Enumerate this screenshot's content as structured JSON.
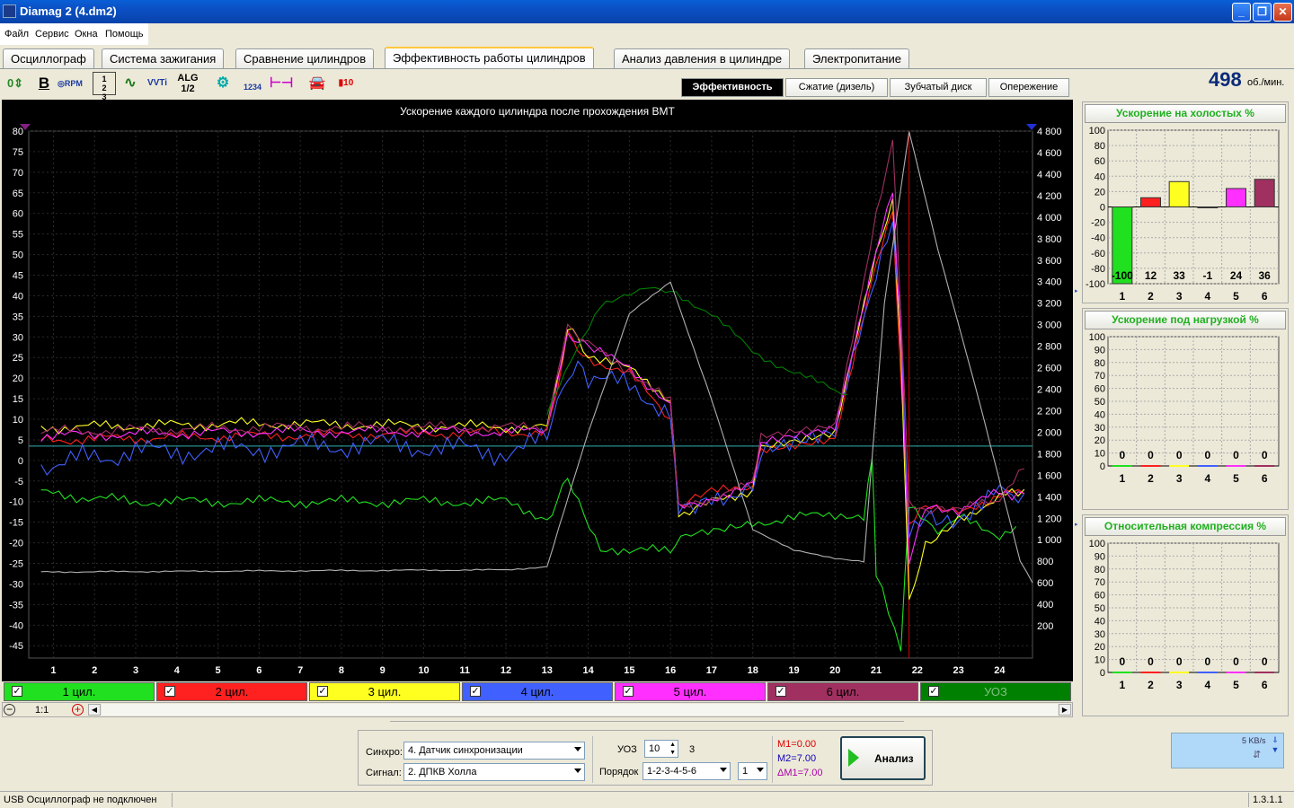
{
  "window": {
    "title": "Diamag 2 (4.dm2)"
  },
  "menu": [
    "Файл",
    "Сервис",
    "Окна",
    "Помощь"
  ],
  "tabs": [
    "Осциллограф",
    "Система зажигания",
    "Сравнение цилиндров",
    "Эффективность работы цилиндров",
    "Анализ давления в цилиндре",
    "Электропитание"
  ],
  "active_tab": 3,
  "toolbar": [
    "0",
    "B",
    "RPM",
    "1|2|3",
    "line",
    "VVTi",
    "ALG 1/2",
    "cyl-icon",
    "1234",
    "sync",
    "car-icon",
    "10"
  ],
  "subtabs": [
    "Эффективность",
    "Сжатие (дизель)",
    "Зубчатый диск",
    "Опережение"
  ],
  "active_subtab": 0,
  "rpm": {
    "value": "498",
    "unit": "об./мин."
  },
  "channels": [
    {
      "label": "1 цил.",
      "color": "#20e020"
    },
    {
      "label": "2 цил.",
      "color": "#ff2020"
    },
    {
      "label": "3 цил.",
      "color": "#ffff20"
    },
    {
      "label": "4 цил.",
      "color": "#4060ff"
    },
    {
      "label": "5 цил.",
      "color": "#ff30ff"
    },
    {
      "label": "6 цил.",
      "color": "#a03060"
    },
    {
      "label": "УОЗ",
      "color": "#008000"
    }
  ],
  "zoom": {
    "label": "1:1"
  },
  "chart_data": [
    {
      "type": "line",
      "title": "Ускорение каждого цилиндра после прохождения ВМТ",
      "xlim": [
        0.4,
        24.8
      ],
      "xticks": [
        1,
        2,
        3,
        4,
        5,
        6,
        7,
        8,
        9,
        10,
        11,
        12,
        13,
        14,
        15,
        16,
        17,
        18,
        19,
        20,
        21,
        22,
        23,
        24
      ],
      "ylim": [
        -48,
        80
      ],
      "yticks": [
        80,
        75,
        70,
        65,
        60,
        55,
        50,
        45,
        40,
        35,
        30,
        25,
        20,
        15,
        10,
        5,
        0,
        -5,
        -10,
        -15,
        -20,
        -25,
        -30,
        -35,
        -40,
        -45
      ],
      "y2lim": [
        -100,
        4800
      ],
      "y2ticks": [
        "4 800",
        "4 600",
        "4 400",
        "4 200",
        "4 000",
        "3 800",
        "3 600",
        "3 400",
        "3 200",
        "3 000",
        "2 800",
        "2 600",
        "2 400",
        "2 200",
        "2 000",
        "1 800",
        "1 600",
        "1 400",
        "1 200",
        "1 000",
        "800",
        "600",
        "400",
        "200"
      ],
      "reference_line": 3.5,
      "series": [
        {
          "name": "1 цил.",
          "color": "#20e020",
          "points": [
            [
              0.7,
              -8
            ],
            [
              3,
              -10
            ],
            [
              6,
              -10
            ],
            [
              9,
              -10
            ],
            [
              12,
              -10
            ],
            [
              13,
              -14
            ],
            [
              13.5,
              -5
            ],
            [
              14.3,
              -21
            ],
            [
              15,
              -22
            ],
            [
              16,
              -22
            ],
            [
              16.5,
              -17
            ],
            [
              18,
              -15
            ],
            [
              20,
              -13
            ],
            [
              20.7,
              -13
            ],
            [
              20.9,
              2
            ],
            [
              21,
              -28
            ],
            [
              21.6,
              -45
            ],
            [
              21.8,
              -10
            ],
            [
              22.5,
              -17
            ],
            [
              23,
              -14
            ],
            [
              24,
              -18
            ],
            [
              24.4,
              -16
            ]
          ]
        },
        {
          "name": "2 цил.",
          "color": "#ff2020",
          "points": [
            [
              0.7,
              5
            ],
            [
              6,
              6
            ],
            [
              13,
              7
            ],
            [
              13.5,
              30
            ],
            [
              14,
              25
            ],
            [
              15,
              21
            ],
            [
              16,
              10
            ],
            [
              16.2,
              -11
            ],
            [
              17,
              -8
            ],
            [
              18,
              -6
            ],
            [
              18.2,
              3
            ],
            [
              20,
              6
            ],
            [
              21,
              47
            ],
            [
              21.4,
              60
            ],
            [
              21.6,
              20
            ],
            [
              21.8,
              -15
            ],
            [
              22.2,
              -10
            ],
            [
              23,
              -13
            ],
            [
              24,
              -8
            ],
            [
              24.6,
              -8
            ]
          ]
        },
        {
          "name": "3 цил.",
          "color": "#ffff20",
          "points": [
            [
              0.7,
              8
            ],
            [
              6,
              9
            ],
            [
              13,
              8
            ],
            [
              13.5,
              32
            ],
            [
              14,
              26
            ],
            [
              15,
              22
            ],
            [
              16,
              15
            ],
            [
              16.2,
              -13
            ],
            [
              17,
              -10
            ],
            [
              18,
              -7
            ],
            [
              18.2,
              4
            ],
            [
              20,
              7
            ],
            [
              21,
              50
            ],
            [
              21.4,
              62
            ],
            [
              21.6,
              25
            ],
            [
              21.8,
              -35
            ],
            [
              22.2,
              -20
            ],
            [
              23,
              -14
            ],
            [
              24,
              -9
            ],
            [
              24.6,
              -7
            ]
          ]
        },
        {
          "name": "4 цил.",
          "color": "#4060ff",
          "points": [
            [
              0.7,
              -1
            ],
            [
              3,
              2
            ],
            [
              6,
              3
            ],
            [
              9,
              4
            ],
            [
              12,
              2
            ],
            [
              13,
              5
            ],
            [
              13.5,
              22
            ],
            [
              14,
              20
            ],
            [
              15,
              18
            ],
            [
              16,
              12
            ],
            [
              16.2,
              -10
            ],
            [
              17,
              -9
            ],
            [
              18,
              -6
            ],
            [
              18.2,
              3
            ],
            [
              20,
              6
            ],
            [
              21,
              46
            ],
            [
              21.4,
              58
            ],
            [
              21.6,
              35
            ],
            [
              21.8,
              -20
            ],
            [
              22.2,
              -14
            ],
            [
              23,
              -13
            ],
            [
              24,
              -8
            ],
            [
              24.6,
              -8
            ]
          ]
        },
        {
          "name": "5 цил.",
          "color": "#ff30ff",
          "points": [
            [
              0.7,
              6
            ],
            [
              6,
              7
            ],
            [
              13,
              7
            ],
            [
              13.5,
              31
            ],
            [
              14,
              27
            ],
            [
              15,
              23
            ],
            [
              16,
              13
            ],
            [
              16.2,
              -11
            ],
            [
              17,
              -9
            ],
            [
              18,
              -6
            ],
            [
              18.2,
              4
            ],
            [
              20,
              7
            ],
            [
              21,
              52
            ],
            [
              21.4,
              66
            ],
            [
              21.6,
              30
            ],
            [
              21.8,
              -25
            ],
            [
              22.2,
              -12
            ],
            [
              23,
              -12
            ],
            [
              24,
              -8
            ],
            [
              24.6,
              -8
            ]
          ]
        },
        {
          "name": "6 цил.",
          "color": "#a03060",
          "points": [
            [
              0.7,
              7
            ],
            [
              6,
              8
            ],
            [
              13,
              8
            ],
            [
              13.5,
              33
            ],
            [
              14,
              28
            ],
            [
              15,
              22
            ],
            [
              16,
              14
            ],
            [
              16.2,
              -12
            ],
            [
              17,
              -9
            ],
            [
              18,
              -6
            ],
            [
              18.2,
              5
            ],
            [
              20,
              8
            ],
            [
              21,
              60
            ],
            [
              21.4,
              78
            ],
            [
              21.6,
              35
            ],
            [
              21.8,
              -10
            ],
            [
              22.2,
              -13
            ],
            [
              23,
              -12
            ],
            [
              24,
              -10
            ],
            [
              24.2,
              -7
            ],
            [
              24.6,
              -2
            ]
          ]
        },
        {
          "name": "УОЗ",
          "color": "#008000",
          "axis": "right",
          "points": [
            [
              13,
              2200
            ],
            [
              14.3,
              3200
            ],
            [
              15,
              3300
            ],
            [
              15.5,
              3340
            ],
            [
              16,
              3320
            ],
            [
              17,
              3100
            ],
            [
              18,
              2750
            ],
            [
              19,
              2550
            ],
            [
              20,
              2400
            ],
            [
              20.3,
              2350
            ]
          ]
        },
        {
          "name": "обороты",
          "color": "#b0b0b0",
          "axis": "right",
          "points": [
            [
              0.7,
              700
            ],
            [
              6,
              710
            ],
            [
              12,
              720
            ],
            [
              13,
              750
            ],
            [
              14,
              2000
            ],
            [
              15,
              3100
            ],
            [
              16,
              3400
            ],
            [
              17,
              2300
            ],
            [
              18,
              1100
            ],
            [
              19,
              900
            ],
            [
              20,
              830
            ],
            [
              20.7,
              800
            ],
            [
              21.2,
              3200
            ],
            [
              21.8,
              4800
            ],
            [
              22.5,
              3700
            ],
            [
              23.5,
              2300
            ],
            [
              24.5,
              800
            ],
            [
              24.8,
              600
            ]
          ]
        }
      ]
    },
    {
      "type": "bar",
      "title": "Ускорение на холостых %",
      "categories": [
        "1",
        "2",
        "3",
        "4",
        "5",
        "6"
      ],
      "values": [
        -100,
        12,
        33,
        -1,
        24,
        36
      ],
      "colors": [
        "#20e020",
        "#ff2020",
        "#ffff20",
        "#4060ff",
        "#ff30ff",
        "#a03060"
      ],
      "ylim": [
        -100,
        100
      ],
      "yticks": [
        100,
        80,
        60,
        40,
        20,
        0,
        -20,
        -40,
        -60,
        -80,
        -100
      ]
    },
    {
      "type": "bar",
      "title": "Ускорение под нагрузкой %",
      "categories": [
        "1",
        "2",
        "3",
        "4",
        "5",
        "6"
      ],
      "values": [
        0,
        0,
        0,
        0,
        0,
        0
      ],
      "colors": [
        "#20e020",
        "#ff2020",
        "#ffff20",
        "#4060ff",
        "#ff30ff",
        "#a03060"
      ],
      "ylim": [
        0,
        100
      ],
      "yticks": [
        100,
        90,
        80,
        70,
        60,
        50,
        40,
        30,
        20,
        10,
        0
      ]
    },
    {
      "type": "bar",
      "title": "Относительная компрессия %",
      "categories": [
        "1",
        "2",
        "3",
        "4",
        "5",
        "6"
      ],
      "values": [
        0,
        0,
        0,
        0,
        0,
        0
      ],
      "colors": [
        "#20e020",
        "#ff2020",
        "#ffff20",
        "#4060ff",
        "#ff30ff",
        "#a03060"
      ],
      "ylim": [
        0,
        100
      ],
      "yticks": [
        100,
        90,
        80,
        70,
        60,
        50,
        40,
        30,
        20,
        10,
        0
      ]
    }
  ],
  "controls": {
    "sync_label": "Синхро:",
    "sync_value": "4.  Датчик синхронизации",
    "signal_label": "Сигнал:",
    "signal_value": "2.  ДПКВ Холла",
    "uoz_label": "УОЗ",
    "uoz_value": "10",
    "uoz_extra": "3",
    "order_label": "Порядок",
    "order_value": "1-2-3-4-5-6",
    "order_num": "1",
    "m1": "M1=0.00",
    "m2": "M2=7.00",
    "dm": "ΔM1=7.00",
    "analyze_label": "Анализ"
  },
  "net": {
    "speed": "5 KB/s"
  },
  "status": {
    "left": "USB Осциллограф не подключен",
    "right": "1.3.1.1"
  }
}
